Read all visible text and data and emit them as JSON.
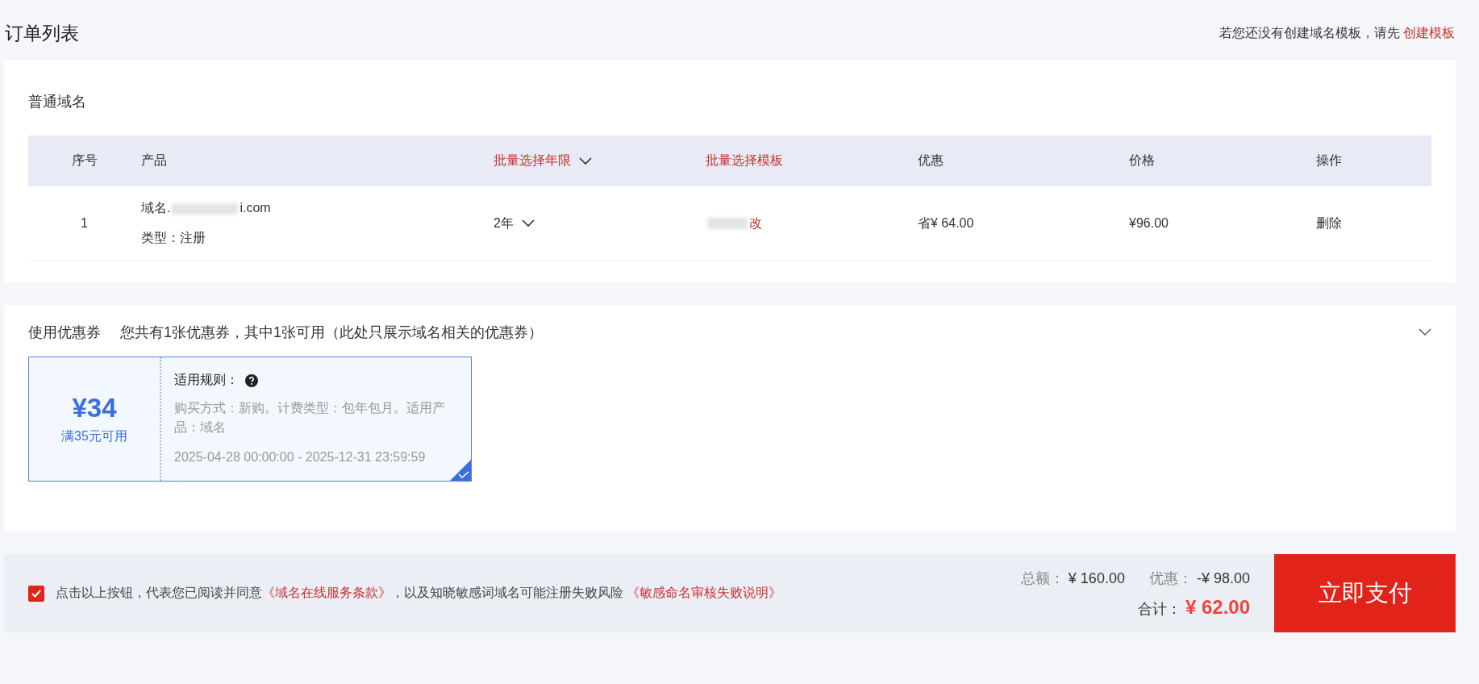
{
  "page_title": "订单列表",
  "template_hint": {
    "text": "若您还没有创建域名模板，请先",
    "link": "创建模板"
  },
  "domain_section": {
    "title": "普通域名",
    "columns": [
      {
        "label": "序号",
        "kind": "plain"
      },
      {
        "label": "产品",
        "kind": "plain"
      },
      {
        "label": "批量选择年限",
        "kind": "dropdown"
      },
      {
        "label": "批量选择模板",
        "kind": "link"
      },
      {
        "label": "优惠",
        "kind": "plain"
      },
      {
        "label": "价格",
        "kind": "plain"
      },
      {
        "label": "操作",
        "kind": "plain"
      }
    ],
    "rows": [
      {
        "index": "1",
        "domain_label": "域名.",
        "domain_suffix": "i.com",
        "type": "类型：注册",
        "years": "2年",
        "template_action": "改",
        "discount": "省¥ 64.00",
        "price": "¥96.00",
        "action": "删除"
      }
    ]
  },
  "coupon_section": {
    "title": "使用优惠券",
    "summary": "您共有1张优惠券，其中1张可用（此处只展示域名相关的优惠券）",
    "expanded": true,
    "coupons": [
      {
        "amount": "¥34",
        "condition": "满35元可用",
        "rules_title": "适用规则：",
        "rules": "购买方式：新购。计费类型：包年包月。适用产品：域名",
        "validity": "2025-04-28 00:00:00 - 2025-12-31 23:59:59",
        "selected": true
      }
    ]
  },
  "footer": {
    "agree_checked": true,
    "agree_text": "点击以上按钮，代表您已阅读并同意",
    "terms_link": "《域名在线服务条款》",
    "middle_text": "，以及知晓敏感词域名可能注册失败风险",
    "policy_link": "《敏感命名审核失败说明》",
    "total_label": "总额：",
    "total": "¥ 160.00",
    "discount_label": "优惠：",
    "discount": "-¥ 98.00",
    "sum_label": "合计：",
    "sum": "¥ 62.00",
    "pay_button": "立即支付"
  }
}
